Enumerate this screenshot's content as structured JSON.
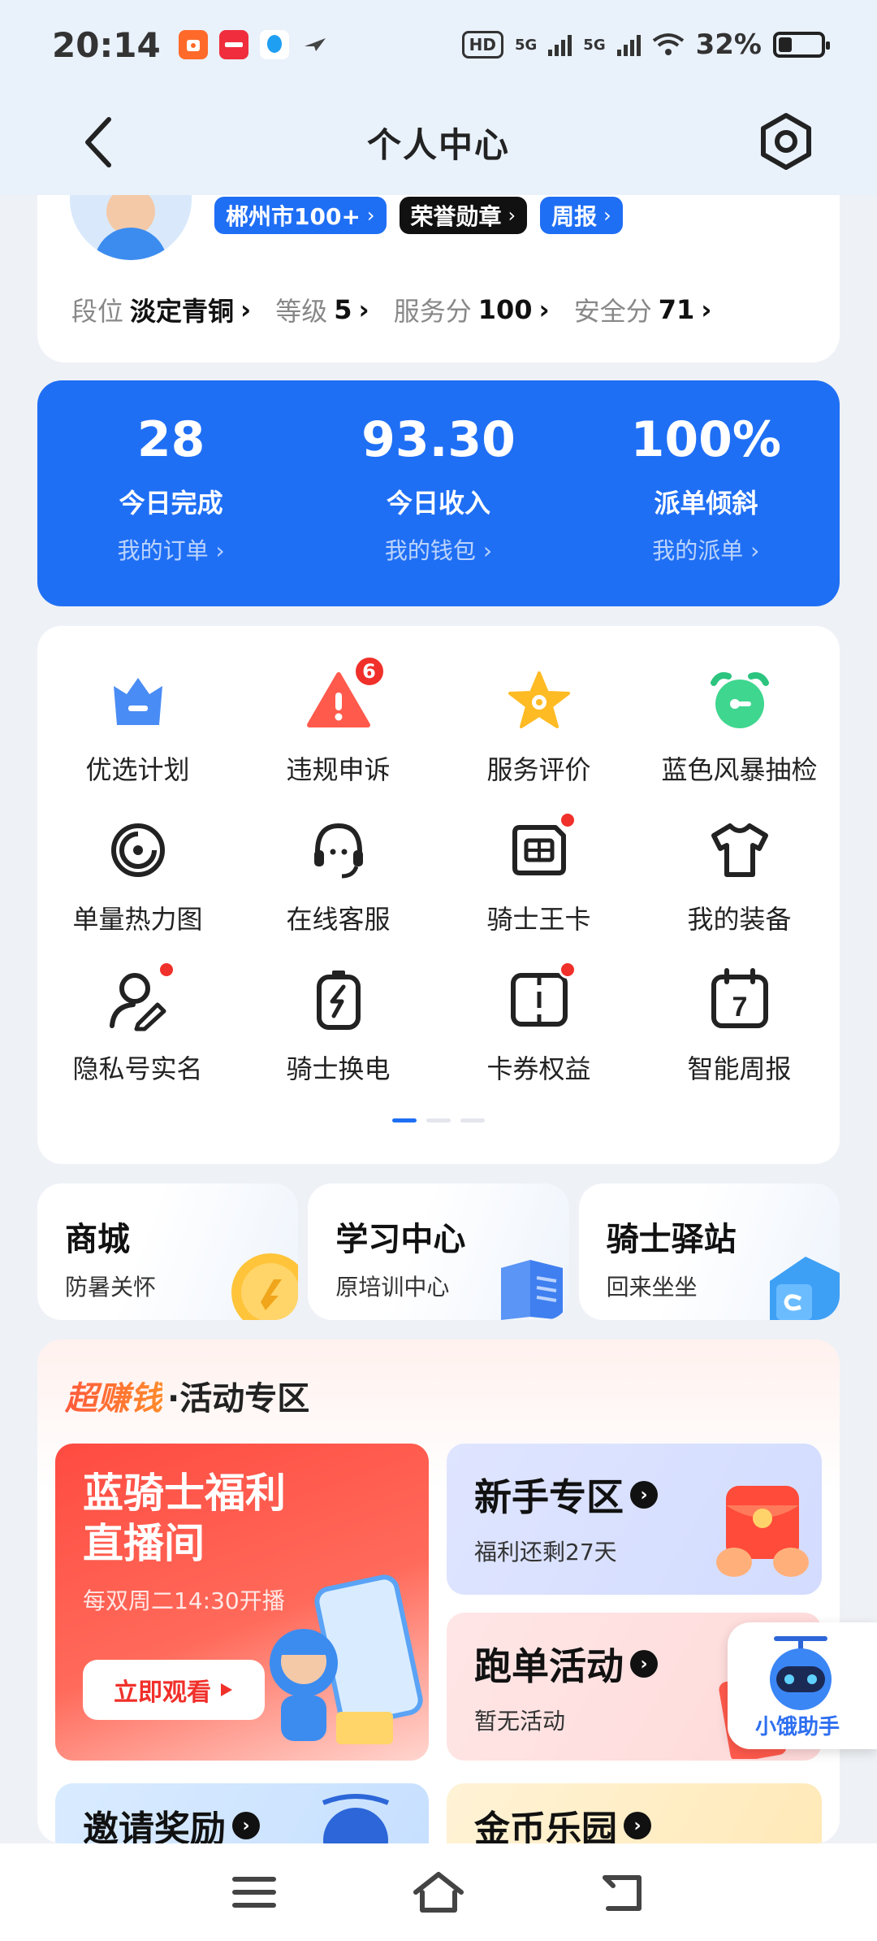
{
  "status_bar": {
    "time": "20:14",
    "battery": "32%",
    "network": [
      "5G",
      "5G"
    ],
    "hd_label": "HD",
    "app_icons": [
      "shopee-app-icon",
      "xiaohongshu-app-icon",
      "qq-app-icon",
      "bird-app-icon"
    ]
  },
  "header": {
    "title": "个人中心"
  },
  "profile": {
    "badges": [
      {
        "label": "郴州市100+",
        "style": "blue"
      },
      {
        "label": "荣誉勋章",
        "style": "black"
      },
      {
        "label": "周报",
        "style": "blue"
      }
    ],
    "stats": [
      {
        "label": "段位",
        "value": "淡定青铜"
      },
      {
        "label": "等级",
        "value": "5"
      },
      {
        "label": "服务分",
        "value": "100"
      },
      {
        "label": "安全分",
        "value": "71"
      }
    ]
  },
  "summary": [
    {
      "value": "28",
      "label": "今日完成",
      "link": "我的订单"
    },
    {
      "value": "93.30",
      "label": "今日收入",
      "link": "我的钱包"
    },
    {
      "value": "100%",
      "label": "派单倾斜",
      "link": "我的派单"
    }
  ],
  "tools": [
    {
      "label": "优选计划",
      "icon": "crown-icon",
      "dot": false,
      "count": null
    },
    {
      "label": "违规申诉",
      "icon": "warning-icon",
      "dot": false,
      "count": "6"
    },
    {
      "label": "服务评价",
      "icon": "star-icon",
      "dot": false,
      "count": null
    },
    {
      "label": "蓝色风暴抽检",
      "icon": "alarm-clock-icon",
      "dot": false,
      "count": null
    },
    {
      "label": "单量热力图",
      "icon": "heatmap-icon",
      "dot": false,
      "count": null
    },
    {
      "label": "在线客服",
      "icon": "headset-icon",
      "dot": false,
      "count": null
    },
    {
      "label": "骑士王卡",
      "icon": "sim-card-icon",
      "dot": true,
      "count": null
    },
    {
      "label": "我的装备",
      "icon": "shirt-icon",
      "dot": false,
      "count": null
    },
    {
      "label": "隐私号实名",
      "icon": "user-edit-icon",
      "dot": true,
      "count": null
    },
    {
      "label": "骑士换电",
      "icon": "battery-swap-icon",
      "dot": false,
      "count": null
    },
    {
      "label": "卡券权益",
      "icon": "coupon-icon",
      "dot": true,
      "count": null
    },
    {
      "label": "智能周报",
      "icon": "calendar-icon",
      "dot": false,
      "count": null
    }
  ],
  "calendar_day": "7",
  "services": [
    {
      "title": "商城",
      "subtitle": "防暑关怀"
    },
    {
      "title": "学习中心",
      "subtitle": "原培训中心"
    },
    {
      "title": "骑士驿站",
      "subtitle": "回来坐坐"
    }
  ],
  "activity": {
    "highlight": "超赚钱",
    "title": "·活动专区",
    "live": {
      "title_line1": "蓝骑士福利",
      "title_line2": "直播间",
      "subtitle": "每双周二14:30开播",
      "button": "立即观看"
    },
    "newbie": {
      "title": "新手专区",
      "subtitle": "福利还剩27天"
    },
    "running": {
      "title": "跑单活动",
      "subtitle": "暂无活动"
    },
    "invite": {
      "title": "邀请奖励"
    },
    "coins": {
      "title": "金币乐园"
    }
  },
  "assistant": {
    "label": "小饿助手"
  },
  "colors": {
    "brand_blue": "#1f6ff5",
    "red_badge": "#f0302a"
  }
}
